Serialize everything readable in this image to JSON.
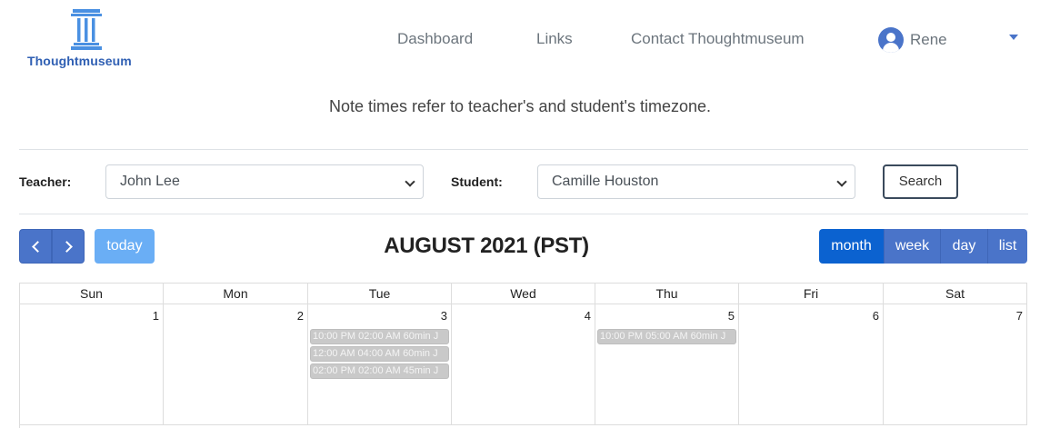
{
  "brand": {
    "name": "Thoughtmuseum",
    "logo_color": "#4a90e2"
  },
  "nav": {
    "dashboard": "Dashboard",
    "links": "Links",
    "contact": "Contact Thoughtmuseum",
    "user_name": "Rene",
    "user_icon": "user-avatar-icon",
    "dropdown_icon": "caret-down-icon"
  },
  "note": "Note times refer to teacher's and student's timezone.",
  "filters": {
    "teacher_label": "Teacher:",
    "teacher_value": "John Lee",
    "student_label": "Student:",
    "student_value": "Camille Houston",
    "search_label": "Search"
  },
  "calendar": {
    "title": "AUGUST 2021 (PST)",
    "today_label": "today",
    "views": [
      "month",
      "week",
      "day",
      "list"
    ],
    "active_view": "month",
    "accent_color": "#4a74c9",
    "active_color": "#0b62d0",
    "weekdays": [
      "Sun",
      "Mon",
      "Tue",
      "Wed",
      "Thu",
      "Fri",
      "Sat"
    ],
    "days": [
      {
        "num": "1",
        "events": []
      },
      {
        "num": "2",
        "events": []
      },
      {
        "num": "3",
        "events": [
          "10:00 PM 02:00 AM 60min J",
          "12:00 AM 04:00 AM 60min J",
          "02:00 PM 02:00 AM 45min J"
        ]
      },
      {
        "num": "4",
        "events": []
      },
      {
        "num": "5",
        "events": [
          "10:00 PM 05:00 AM 60min J"
        ]
      },
      {
        "num": "6",
        "events": []
      },
      {
        "num": "7",
        "events": []
      }
    ]
  }
}
